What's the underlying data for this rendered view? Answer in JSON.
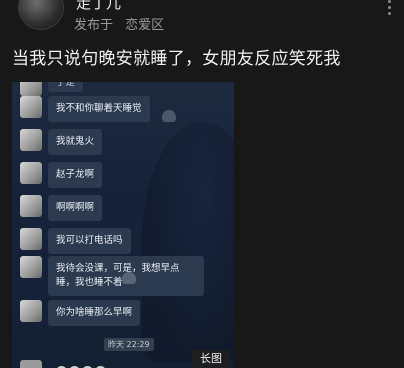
{
  "post": {
    "username": "走丁儿",
    "posted_in_prefix": "发布于",
    "category": "恋爱区",
    "title": "当我只说句晚安就睡了，女朋友反应笑死我"
  },
  "chat": {
    "messages": [
      {
        "text": "于是"
      },
      {
        "text": "我不和你聊着天睡觉"
      },
      {
        "text": "我就鬼火"
      },
      {
        "text": "赵子龙啊"
      },
      {
        "text": "啊啊啊啊"
      },
      {
        "text": "我可以打电话吗"
      },
      {
        "text": "我待会没课，可是，我想早点睡，我也睡不着"
      },
      {
        "text": "你为啥睡那么早啊"
      }
    ],
    "timestamp": "昨天 22:29",
    "long_image_badge": "长图"
  },
  "colors": {
    "background": "#181818",
    "chat_bg": "#1b2740",
    "bubble": "#2b3a4e"
  }
}
